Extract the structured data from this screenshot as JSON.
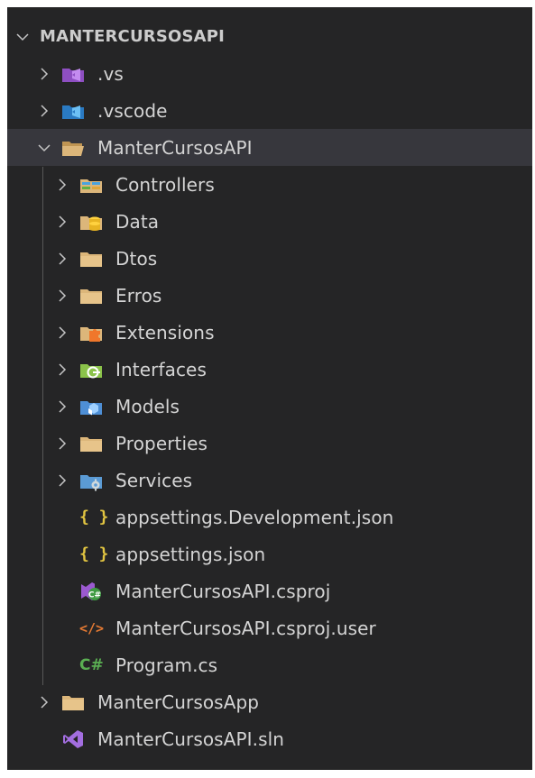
{
  "explorer": {
    "root_label": "MANTERCURSOSAPI",
    "items": [
      {
        "label": ".vs"
      },
      {
        "label": ".vscode"
      },
      {
        "label": "ManterCursosAPI"
      },
      {
        "label": "Controllers"
      },
      {
        "label": "Data"
      },
      {
        "label": "Dtos"
      },
      {
        "label": "Erros"
      },
      {
        "label": "Extensions"
      },
      {
        "label": "Interfaces"
      },
      {
        "label": "Models"
      },
      {
        "label": "Properties"
      },
      {
        "label": "Services"
      },
      {
        "label": "appsettings.Development.json"
      },
      {
        "label": "appsettings.json"
      },
      {
        "label": "ManterCursosAPI.csproj"
      },
      {
        "label": "ManterCursosAPI.csproj.user"
      },
      {
        "label": "Program.cs"
      },
      {
        "label": "ManterCursosApp"
      },
      {
        "label": "ManterCursosAPI.sln"
      }
    ]
  },
  "icons": {
    "json_glyph": "{ }",
    "xml_glyph": "</>",
    "cs_glyph": "C#"
  },
  "colors": {
    "background": "#252526",
    "selected_row": "#37373d",
    "folder": "#dcb67a",
    "json": "#e2c541",
    "xml": "#e37933",
    "csharp": "#5aae52",
    "vs_purple": "#9b59d0",
    "vscode_blue": "#3c99dc"
  }
}
